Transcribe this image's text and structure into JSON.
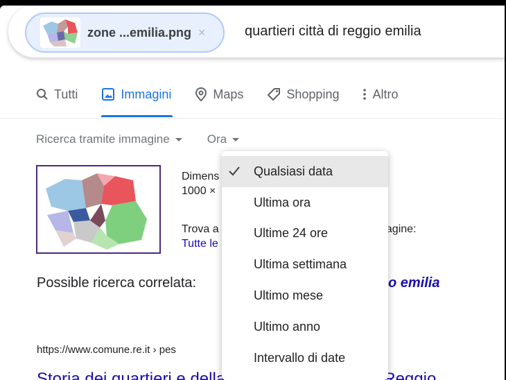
{
  "search": {
    "chip_label": "zone ...emilia.png",
    "chip_close": "×",
    "query": "quartieri città di reggio emilia"
  },
  "tabs": [
    {
      "label": "Tutti",
      "icon": "search-icon",
      "active": false
    },
    {
      "label": "Immagini",
      "icon": "image-icon",
      "active": true
    },
    {
      "label": "Maps",
      "icon": "map-pin-icon",
      "active": false
    },
    {
      "label": "Shopping",
      "icon": "tag-icon",
      "active": false
    },
    {
      "label": "Altro",
      "icon": "more-vert-icon",
      "active": false
    }
  ],
  "tools": {
    "image_search": "Ricerca tramite immagine",
    "time": "Ora"
  },
  "image_result": {
    "dimensions_label": "Dimens",
    "dimensions_value": "1000 ×",
    "find_label": "Trova a",
    "find_suffix": "nagine:",
    "all_link": "Tutte le"
  },
  "related": {
    "label": "Possible ricerca correlata:",
    "query": "o emilia"
  },
  "result": {
    "url": "https://www.comune.re.it › pes",
    "title": "Storia dei quartieri e della frazioni - Comune di Reggio"
  },
  "time_menu": {
    "items": [
      {
        "label": "Qualsiasi data",
        "selected": true
      },
      {
        "label": "Ultima ora",
        "selected": false
      },
      {
        "label": "Ultime 24 ore",
        "selected": false
      },
      {
        "label": "Ultima settimana",
        "selected": false
      },
      {
        "label": "Ultimo mese",
        "selected": false
      },
      {
        "label": "Ultimo anno",
        "selected": false
      },
      {
        "label": "Intervallo di date",
        "selected": false
      }
    ]
  },
  "colors": {
    "accent": "#1a73e8",
    "link": "#1a0dab",
    "chip_bg": "#e8f0fe",
    "thumb_border": "#4b2a7b"
  }
}
